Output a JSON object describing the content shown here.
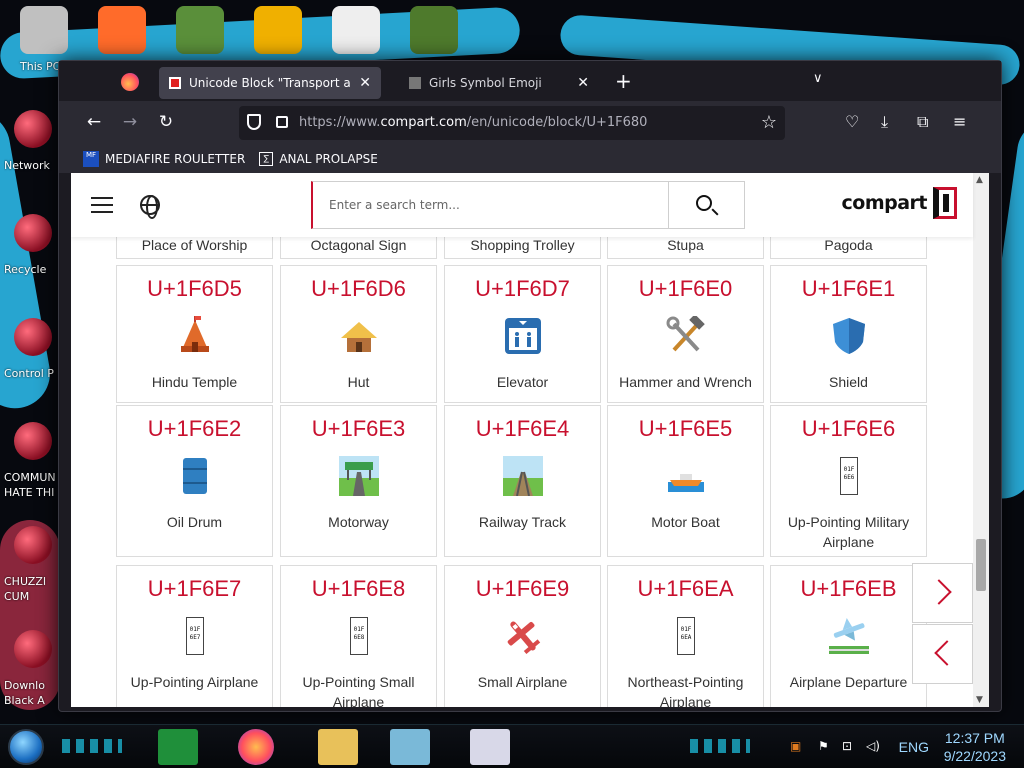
{
  "desktop": {
    "top_icons": [
      {
        "label": "This PC",
        "name": "this-pc-icon",
        "color": "#c0c0c0"
      },
      {
        "label": "",
        "name": "firefox-desktop-icon",
        "color": "#ff6b2a"
      },
      {
        "label": "",
        "name": "flower-app-icon",
        "color": "#5a8f3a"
      },
      {
        "label": "",
        "name": "de-app-icon",
        "color": "#f0b000"
      },
      {
        "label": "",
        "name": "pixel-cat-icon",
        "color": "#eeeeee"
      },
      {
        "label": "",
        "name": "minecraft-icon",
        "color": "#4e7a2c"
      }
    ],
    "side_icons": [
      {
        "label": "Network",
        "name": "network-icon"
      },
      {
        "label": "Recycle",
        "name": "recycle-bin-icon"
      },
      {
        "label": "Control P",
        "name": "control-panel-icon"
      },
      {
        "label": "COMMUN HATE THI",
        "name": "money-bag-icon"
      },
      {
        "label": "CHUZZI CUM",
        "name": "chuzzle-icon"
      },
      {
        "label": "Downlo Black A",
        "name": "download-icon"
      }
    ]
  },
  "browser": {
    "tabs": [
      {
        "title": "Unicode Block \"Transport and M",
        "active": true
      },
      {
        "title": "Girls Symbol Emoji",
        "active": false
      }
    ],
    "new_tab": "+",
    "tab_list": "∨",
    "url_prefix": "https://www.",
    "url_host": "compart.com",
    "url_path": "/en/unicode/block/U+1F680",
    "bookmarks": [
      {
        "label": "MEDIAFIRE ROULETTER",
        "icon_text": "MF"
      },
      {
        "label": "ANAL PROLAPSE",
        "icon_text": "∑"
      }
    ]
  },
  "site": {
    "search_placeholder": "Enter a search term...",
    "logo_text": "compart",
    "cards_top_partial": [
      {
        "name": "Place of Worship"
      },
      {
        "name": "Octagonal Sign"
      },
      {
        "name": "Shopping Trolley"
      },
      {
        "name": "Stupa"
      },
      {
        "name": "Pagoda"
      }
    ],
    "rows": [
      [
        {
          "code": "U+1F6D5",
          "name": "Hindu Temple",
          "glyph": "hindu-temple"
        },
        {
          "code": "U+1F6D6",
          "name": "Hut",
          "glyph": "hut"
        },
        {
          "code": "U+1F6D7",
          "name": "Elevator",
          "glyph": "elevator"
        },
        {
          "code": "U+1F6E0",
          "name": "Hammer and Wrench",
          "glyph": "hammer-wrench"
        },
        {
          "code": "U+1F6E1",
          "name": "Shield",
          "glyph": "shield"
        }
      ],
      [
        {
          "code": "U+1F6E2",
          "name": "Oil Drum",
          "glyph": "oil-drum"
        },
        {
          "code": "U+1F6E3",
          "name": "Motorway",
          "glyph": "motorway"
        },
        {
          "code": "U+1F6E4",
          "name": "Railway Track",
          "glyph": "railway-track"
        },
        {
          "code": "U+1F6E5",
          "name": "Motor Boat",
          "glyph": "motor-boat"
        },
        {
          "code": "U+1F6E6",
          "name": "Up-Pointing Military Airplane",
          "glyph": "hexbox",
          "hex": "01F6E6"
        }
      ],
      [
        {
          "code": "U+1F6E7",
          "name": "Up-Pointing Airplane",
          "glyph": "hexbox",
          "hex": "01F6E7"
        },
        {
          "code": "U+1F6E8",
          "name": "Up-Pointing Small Airplane",
          "glyph": "hexbox",
          "hex": "01F6E8"
        },
        {
          "code": "U+1F6E9",
          "name": "Small Airplane",
          "glyph": "small-airplane"
        },
        {
          "code": "U+1F6EA",
          "name": "Northeast-Pointing Airplane",
          "glyph": "hexbox",
          "hex": "01F6EA"
        },
        {
          "code": "U+1F6EB",
          "name": "Airplane Departure",
          "glyph": "airplane-departure"
        }
      ]
    ]
  },
  "taskbar": {
    "language": "ENG",
    "time": "12:37 PM",
    "date": "9/22/2023"
  },
  "colors": {
    "accent": "#c8102e",
    "firefox_chrome": "#2b2a33"
  }
}
